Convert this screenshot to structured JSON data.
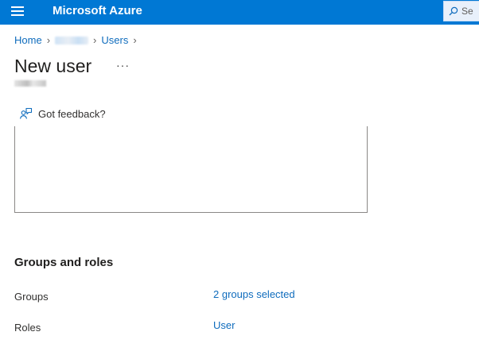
{
  "topbar": {
    "brand": "Microsoft Azure",
    "search_text": "Se"
  },
  "breadcrumb": {
    "home": "Home",
    "middle": "",
    "users": "Users"
  },
  "page": {
    "title": "New user",
    "more": "···"
  },
  "feedback": {
    "label": "Got feedback?"
  },
  "groups_roles": {
    "title": "Groups and roles",
    "groups_label": "Groups",
    "groups_value": "2 groups selected",
    "roles_label": "Roles",
    "roles_value": "User"
  },
  "colors": {
    "accent": "#0078d4",
    "link": "#0f6cbd"
  }
}
